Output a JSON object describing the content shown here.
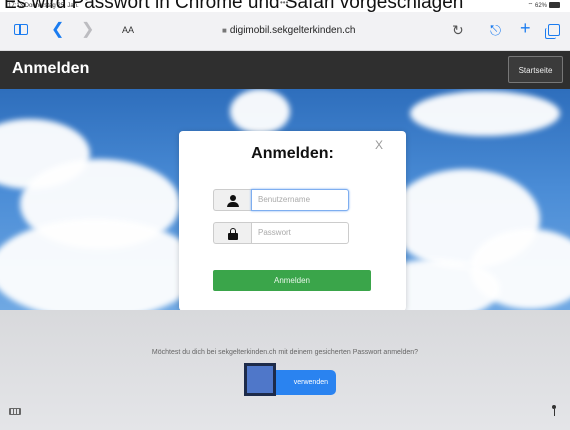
{
  "caption": "Es wird Passwort in Chrome und Safari vorgeschlagen",
  "status_bar": {
    "time": "17:13  Donnerstag 25. Jan.",
    "dots": "•••",
    "wifi_battery": "⌔ 62%"
  },
  "browser": {
    "text_size_label": "AA",
    "url": "digimobil.sekgelterkinden.ch",
    "icons": [
      "sidebar-icon",
      "back-icon",
      "forward-icon",
      "lock-icon",
      "reload-icon",
      "share-icon",
      "plus-icon",
      "tabs-icon"
    ]
  },
  "site_header": {
    "title": "Anmelden",
    "home_button": "Startseite"
  },
  "dialog": {
    "title": "Anmelden:",
    "close": "X",
    "username_placeholder": "Benutzername",
    "password_placeholder": "Passwort",
    "submit_label": "Anmelden"
  },
  "password_prompt": {
    "question": "Möchtest du dich bei sekgelterkinden.ch mit deinem gesicherten Passwort anmelden?",
    "use_button": "verwenden"
  },
  "colors": {
    "header_bg": "#2f2f2f",
    "sky": "#3f80cc",
    "submit_green": "#3aa54a",
    "use_blue": "#2a83f0",
    "overlay_blue": "#4f77c9",
    "link_blue": "#1b7cf0"
  }
}
